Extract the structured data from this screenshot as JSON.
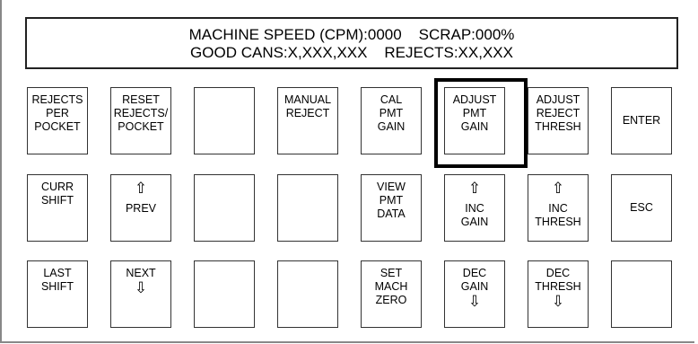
{
  "display": {
    "line1": "MACHINE SPEED (CPM):0000    SCRAP:000%",
    "line2": "GOOD CANS:X,XXX,XXX    REJECTS:XX,XXX"
  },
  "buttons": {
    "rejects_per_pocket": [
      "REJECTS",
      "PER",
      "POCKET"
    ],
    "reset_rejects_pocket": [
      "RESET",
      "REJECTS/",
      "POCKET"
    ],
    "manual_reject": [
      "MANUAL",
      "REJECT"
    ],
    "cal_pmt_gain": [
      "CAL",
      "PMT",
      "GAIN"
    ],
    "adjust_pmt_gain": [
      "ADJUST",
      "PMT",
      "GAIN"
    ],
    "adjust_reject_thresh": [
      "ADJUST",
      "REJECT",
      "THRESH"
    ],
    "enter": "ENTER",
    "curr_shift": [
      "CURR",
      "SHIFT"
    ],
    "prev": {
      "arrow": "⇧",
      "label": "PREV"
    },
    "view_pmt_data": [
      "VIEW",
      "PMT",
      "DATA"
    ],
    "inc_gain": {
      "arrow": "⇧",
      "label": [
        "INC",
        "GAIN"
      ]
    },
    "inc_thresh": {
      "arrow": "⇧",
      "label": [
        "INC",
        "THRESH"
      ]
    },
    "esc": "ESC",
    "last_shift": [
      "LAST",
      "SHIFT"
    ],
    "next": {
      "label": "NEXT",
      "arrow": "⇩"
    },
    "set_mach_zero": [
      "SET",
      "MACH",
      "ZERO"
    ],
    "dec_gain": {
      "label": [
        "DEC",
        "GAIN"
      ],
      "arrow": "⇩"
    },
    "dec_thresh": {
      "label": [
        "DEC",
        "THRESH"
      ],
      "arrow": "⇩"
    }
  }
}
